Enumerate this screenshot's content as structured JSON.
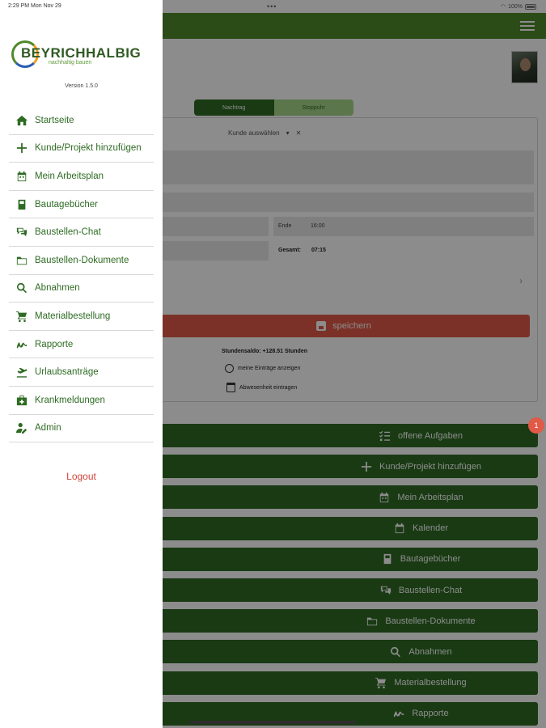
{
  "status_bar": {
    "time": "2:29 PM   Mon Nov 29",
    "dots": "•••",
    "battery": "100%"
  },
  "drawer": {
    "logo_text": "BEYRICHHALBIG",
    "logo_tagline": "nachhaltig bauen",
    "version": "Version 1.5.0",
    "items": [
      {
        "label": "Startseite",
        "icon": "home-icon"
      },
      {
        "label": "Kunde/Projekt hinzufügen",
        "icon": "plus-icon"
      },
      {
        "label": "Mein Arbeitsplan",
        "icon": "calendar-icon"
      },
      {
        "label": "Bautagebücher",
        "icon": "book-icon"
      },
      {
        "label": "Baustellen-Chat",
        "icon": "chat-icon"
      },
      {
        "label": "Baustellen-Dokumente",
        "icon": "folder-icon"
      },
      {
        "label": "Abnahmen",
        "icon": "search-icon"
      },
      {
        "label": "Materialbestellung",
        "icon": "cart-icon"
      },
      {
        "label": "Rapporte",
        "icon": "signature-icon"
      },
      {
        "label": "Urlaubsanträge",
        "icon": "plane-icon"
      },
      {
        "label": "Krankmeldungen",
        "icon": "medkit-icon"
      },
      {
        "label": "Admin",
        "icon": "user-edit-icon"
      }
    ],
    "logout": "Logout"
  },
  "main": {
    "segment": {
      "left": "Nachtrag",
      "right": "Stoppuhr"
    },
    "customer_select": "Kunde auswählen",
    "end_label": "Ende",
    "end_value": "16:00",
    "total_label": "Gesamt:",
    "total_value": "07:15",
    "save_label": "speichern",
    "hours_balance": "Stundensaldo: +128.51 Stunden",
    "show_entries": "meine Einträge anzeigen",
    "enter_absence": "Abwesenheit eintragen",
    "badge_count": "1",
    "buttons": [
      {
        "label": "offene Aufgaben",
        "icon": "tasks-icon"
      },
      {
        "label": "Kunde/Projekt hinzufügen",
        "icon": "plus-icon"
      },
      {
        "label": "Mein Arbeitsplan",
        "icon": "calendar-icon"
      },
      {
        "label": "Kalender",
        "icon": "calendar-blank-icon"
      },
      {
        "label": "Bautagebücher",
        "icon": "book-icon"
      },
      {
        "label": "Baustellen-Chat",
        "icon": "chat-icon"
      },
      {
        "label": "Baustellen-Dokumente",
        "icon": "folder-icon"
      },
      {
        "label": "Abnahmen",
        "icon": "search-icon"
      },
      {
        "label": "Materialbestellung",
        "icon": "cart-icon"
      },
      {
        "label": "Rapporte",
        "icon": "signature-icon"
      }
    ]
  },
  "colors": {
    "brand_green": "#2e6b23",
    "topbar_green": "#4f8a2b",
    "danger": "#e05a47"
  }
}
